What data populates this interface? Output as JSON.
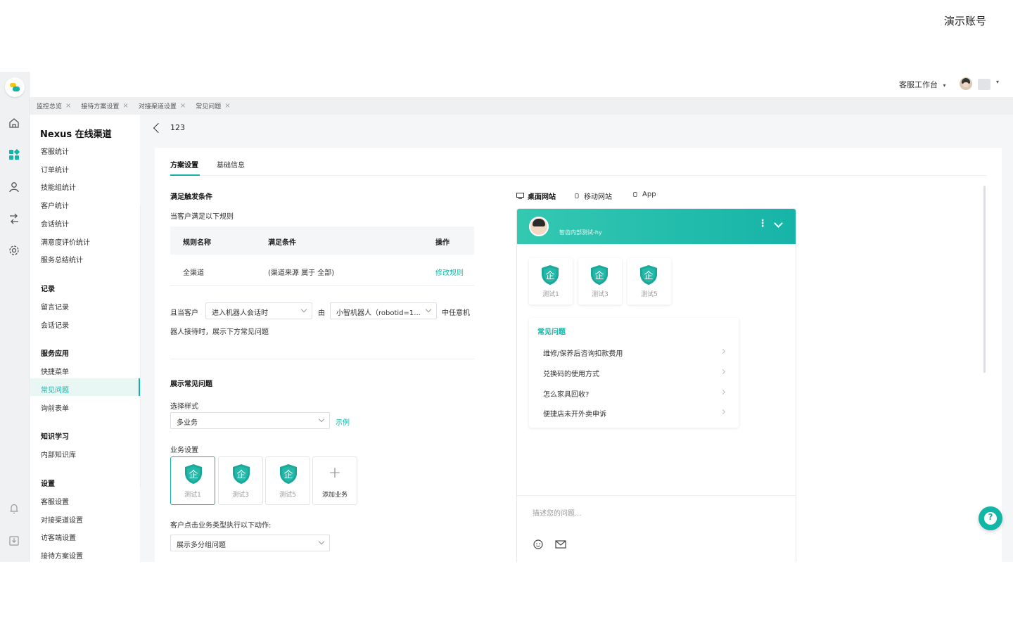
{
  "demo_account_label": "演示账号",
  "header": {
    "workbench_label": "客服工作台",
    "workbench_caret": "▾",
    "user_caret": "▾"
  },
  "tabs": [
    {
      "label": "监控总览",
      "close": "×"
    },
    {
      "label": "接待方案设置",
      "close": "×"
    },
    {
      "label": "对接渠道设置",
      "close": "×"
    },
    {
      "label": "常见问题",
      "close": "×"
    }
  ],
  "sidenav": {
    "brand": "Nexus 在线渠道",
    "stats_items": [
      "客服统计",
      "订单统计",
      "技能组统计",
      "客户统计",
      "会话统计",
      "满意度评价统计",
      "服务总结统计"
    ],
    "records_title": "记录",
    "records_items": [
      "留言记录",
      "会话记录"
    ],
    "service_title": "服务应用",
    "service_items": [
      "快捷菜单",
      "常见问题",
      "询前表单"
    ],
    "knowledge_title": "知识学习",
    "knowledge_items": [
      "内部知识库"
    ],
    "settings_title": "设置",
    "settings_items": [
      "客服设置",
      "对接渠道设置",
      "访客端设置",
      "接待方案设置"
    ]
  },
  "page": {
    "back_title": "123",
    "subtabs": [
      "方案设置",
      "基础信息"
    ],
    "trigger_title": "满足触发条件",
    "trigger_desc": "当客户满足以下规则",
    "rule_table": {
      "headers": [
        "规则名称",
        "满足条件",
        "操作"
      ],
      "rows": [
        {
          "name": "全渠道",
          "condition": "(渠道来源 属于 全部)",
          "action": "修改规则"
        }
      ]
    },
    "cond_prefix": "且当客户",
    "cond_select": "进入机器人会话时",
    "cond_by": "由",
    "robot_select": "小智机器人（robotid=1...",
    "cond_suffix": "中任意机",
    "cond_line2": "器人接待时，展示下方常见问题",
    "show_title": "展示常见问题",
    "style_label": "选择样式",
    "style_value": "多业务",
    "example_link": "示例",
    "biz_label": "业务设置",
    "biz_items": [
      "测试1",
      "测试3",
      "测试5"
    ],
    "add_biz": "添加业务",
    "add_plus": "+",
    "action_label": "客户点击业务类型执行以下动作:",
    "action_value": "展示多分组问题"
  },
  "preview": {
    "tabs": [
      "桌面网站",
      "移动网站",
      "App"
    ],
    "agent_name": "智齿内部测试-hy",
    "more_glyph": "⋮",
    "biz_items": [
      "测试1",
      "测试3",
      "测试5"
    ],
    "faq_title": "常见问题",
    "faq_items": [
      "维修/保养后咨询扣款费用",
      "兑换码的使用方式",
      "怎么家具回收?",
      "便捷店未开外卖申诉"
    ],
    "input_placeholder": "描述您的问题..."
  },
  "help_glyph": "?",
  "colors": {
    "accent": "#13b5a6",
    "header_gradient_start": "#34c8b1",
    "header_gradient_end": "#16b4a8"
  }
}
